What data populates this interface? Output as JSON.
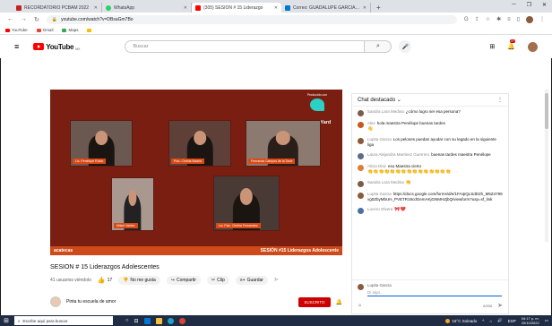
{
  "browser": {
    "tabs": [
      {
        "label": "RECORDATORIO PCBAM 2022",
        "favicon_color": "#c5221f",
        "active": false
      },
      {
        "label": "WhatsApp",
        "favicon_color": "#25d366",
        "active": false
      },
      {
        "label": "(305) SESION # 15 Liderazgo",
        "favicon_color": "#ff0000",
        "active": true
      },
      {
        "label": "Correo: GUADALUPE GARCIA CO",
        "favicon_color": "#0078d4",
        "active": false
      }
    ],
    "new_tab": "+",
    "url": "youtube.com/watch?v=DBsaGm7Bo",
    "bookmarks": [
      {
        "label": "YouTube",
        "color": "#ff0000"
      },
      {
        "label": "Gmail",
        "color": "#ea4335"
      },
      {
        "label": "Maps",
        "color": "#34a853"
      },
      {
        "label": "",
        "color": "#fbbc04"
      }
    ]
  },
  "youtube": {
    "logo_text": "YouTube",
    "logo_suffix": "MX",
    "search_placeholder": "Buscar",
    "notification_count": "9+"
  },
  "video": {
    "overlay_small": "Producido con",
    "overlay_brand": "StreamYard",
    "banner_left": "acatecas",
    "banner_right": "SESIÓN #15 Liderazgos Adolescente",
    "participants": [
      {
        "name": "Lic. Penélope Rubio"
      },
      {
        "name": "Psic. Cinthia Madrid"
      },
      {
        "name": "Fernanda Campos de la Torre"
      },
      {
        "name": "Mitzel Valdez"
      },
      {
        "name": "Lic. Psic. Cinthia Fernandez"
      }
    ],
    "title": "SESION # 15 Liderazgos Adolescentes",
    "viewers": "41 usuarios viéndolo",
    "likes": "17",
    "dislike_label": "No me gusta",
    "share_label": "Compartir",
    "clip_label": "Clip",
    "save_label": "Guardar",
    "channel_name": "Pinta tu escuela de amor",
    "subscribe_label": "SUSCRITO"
  },
  "chat": {
    "header": "Chat destacado",
    "messages": [
      {
        "name": "Sandra Lara Medina",
        "text": "¿cómo logro ser esa persona?",
        "color": "#7a5c4a"
      },
      {
        "name": "Alex",
        "text": "hola maestra Penélope buenas tardes",
        "color": "#c45a1e",
        "emoji": "👋"
      },
      {
        "name": "Lupita Garcia",
        "text": "Los pelones puedan ayudar con su legado en la siguiente liga",
        "color": "#8a5a3c"
      },
      {
        "name": "Laura Alejandra Martinez Guerrero",
        "text": "buenas tardes maestra Penélope",
        "color": "#5b6b8a"
      },
      {
        "name": "Alicia Diaz",
        "text": "eso Maestra cierto",
        "color": "#e07b39",
        "emoji": "👏👏👏👏👏👏👏👏👏👏👏👏👏👏👏"
      },
      {
        "name": "Sandra Lara Medina",
        "text": "",
        "color": "#7a5c4a",
        "emoji": "👏"
      },
      {
        "name": "Lupita Garcia",
        "text": "https://docs.google.com/forms/d/e/1FAIpQLSdD2h_M5Z4799vg0ZbyMbUH_PVETR19cdGemAKjGNMHZjbQ/viewform?usp=sf_link",
        "color": "#8a5a3c"
      },
      {
        "name": "Lucero Olvera",
        "text": "",
        "color": "#4a6fa5",
        "emoji": "🎀❤️"
      }
    ],
    "input_name": "Lupita Garcia",
    "input_placeholder": "Di algo...",
    "char_count": "0/200"
  },
  "taskbar": {
    "search_placeholder": "Escribe aquí para buscar",
    "weather": "16°C Soleado",
    "language": "ESP",
    "time": "04:17 p. m.",
    "date": "20/10/2022"
  }
}
